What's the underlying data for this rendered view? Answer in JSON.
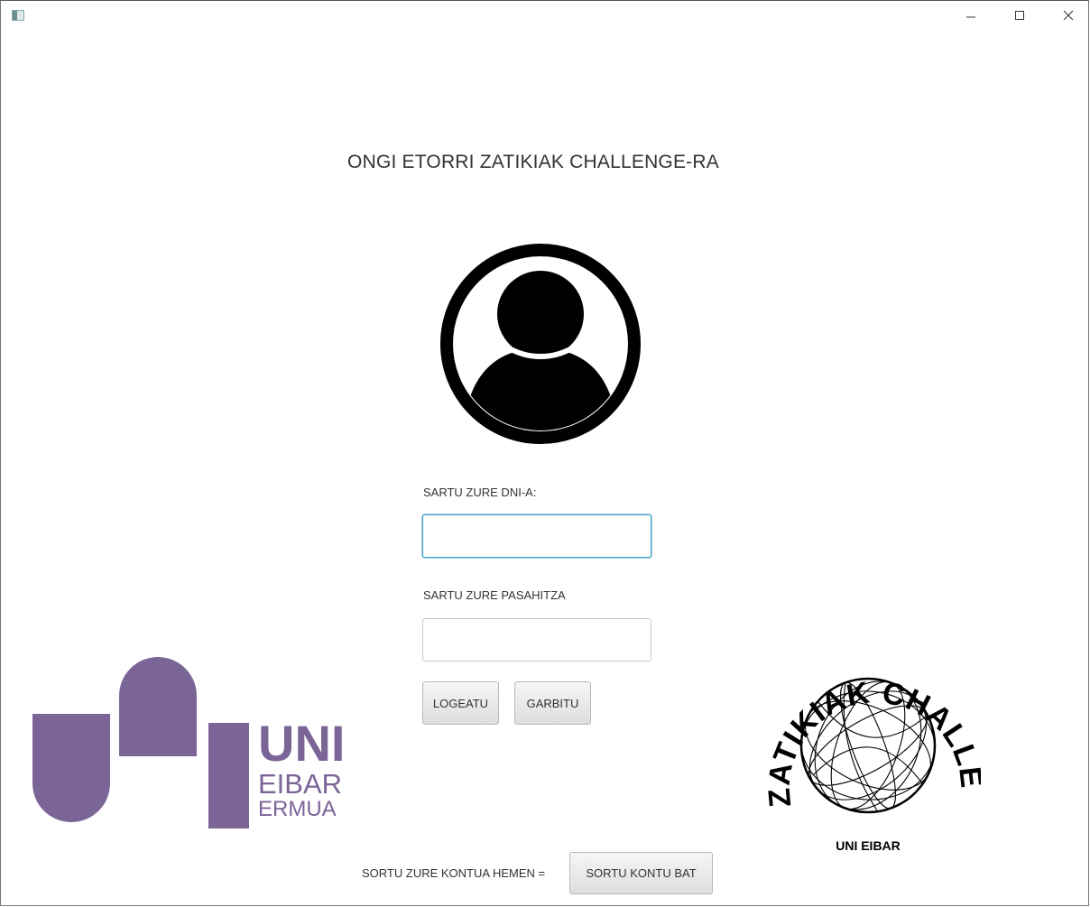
{
  "window": {
    "minimize_icon": "minimize-icon",
    "maximize_icon": "maximize-icon",
    "close_icon": "close-icon"
  },
  "main": {
    "heading": "ONGI ETORRI ZATIKIAK CHALLENGE-RA",
    "avatar_icon": "user-avatar-icon",
    "dni_label": "SARTU ZURE DNI-A:",
    "dni_value": "",
    "password_label": "SARTU ZURE PASAHITZA",
    "password_value": "",
    "login_button": "LOGEATU",
    "clear_button": "GARBITU",
    "create_prompt": "SORTU ZURE KONTUA HEMEN =",
    "create_button": "SORTU KONTU BAT"
  },
  "logos": {
    "uni_line1": "UNI",
    "uni_line2": "EIBAR",
    "uni_line3": "ERMUA",
    "zatikiak_ring_text": "ZATIKIAK CHALLENGE",
    "zatikiak_bottom_text": "UNI EIBAR"
  },
  "colors": {
    "uni_purple": "#7b6496",
    "focus_border": "#3a9fc7",
    "icon_black": "#000000"
  }
}
